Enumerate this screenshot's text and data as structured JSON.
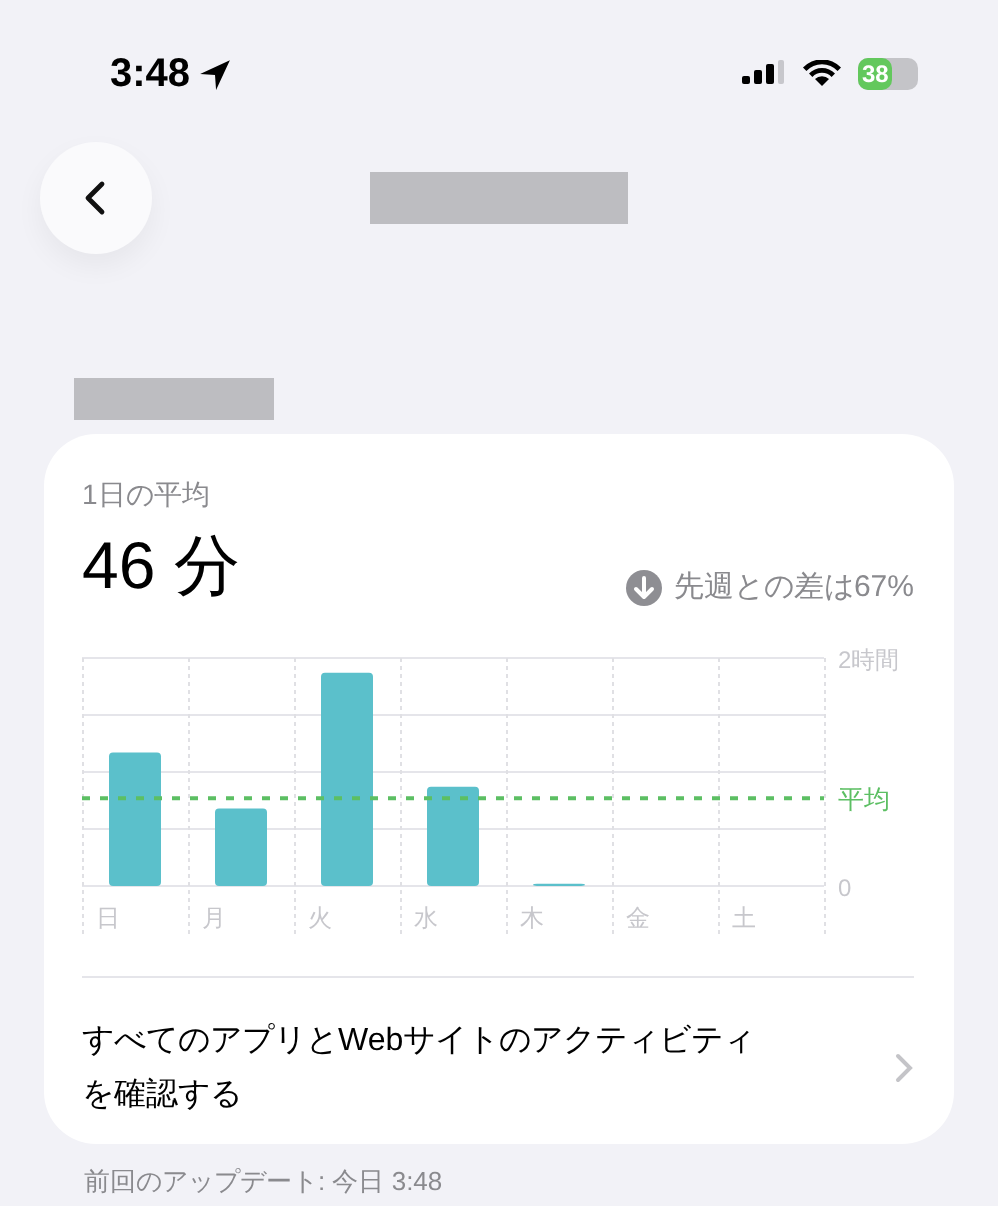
{
  "status_bar": {
    "time": "3:48",
    "battery": "38"
  },
  "summary": {
    "label": "1日の平均",
    "value": "46 分",
    "change": "先週との差は67%"
  },
  "chart_data": {
    "type": "bar",
    "categories": [
      "日",
      "月",
      "火",
      "水",
      "木",
      "金",
      "土"
    ],
    "values": [
      1.17,
      0.68,
      1.87,
      0.87,
      0.02,
      0,
      0
    ],
    "color": "#5bc0cb",
    "ylim": [
      0,
      2
    ],
    "yticks": [
      0,
      {
        "value": 2,
        "label": "2時間"
      }
    ],
    "ref_lines": [
      {
        "axis": "y",
        "value": 0.77,
        "label": "平均",
        "color": "#5cbf63"
      }
    ]
  },
  "link": {
    "text": "すべてのアプリとWebサイトのアクティビティを確認する"
  },
  "footer": "前回のアップデート: 今日 3:48"
}
